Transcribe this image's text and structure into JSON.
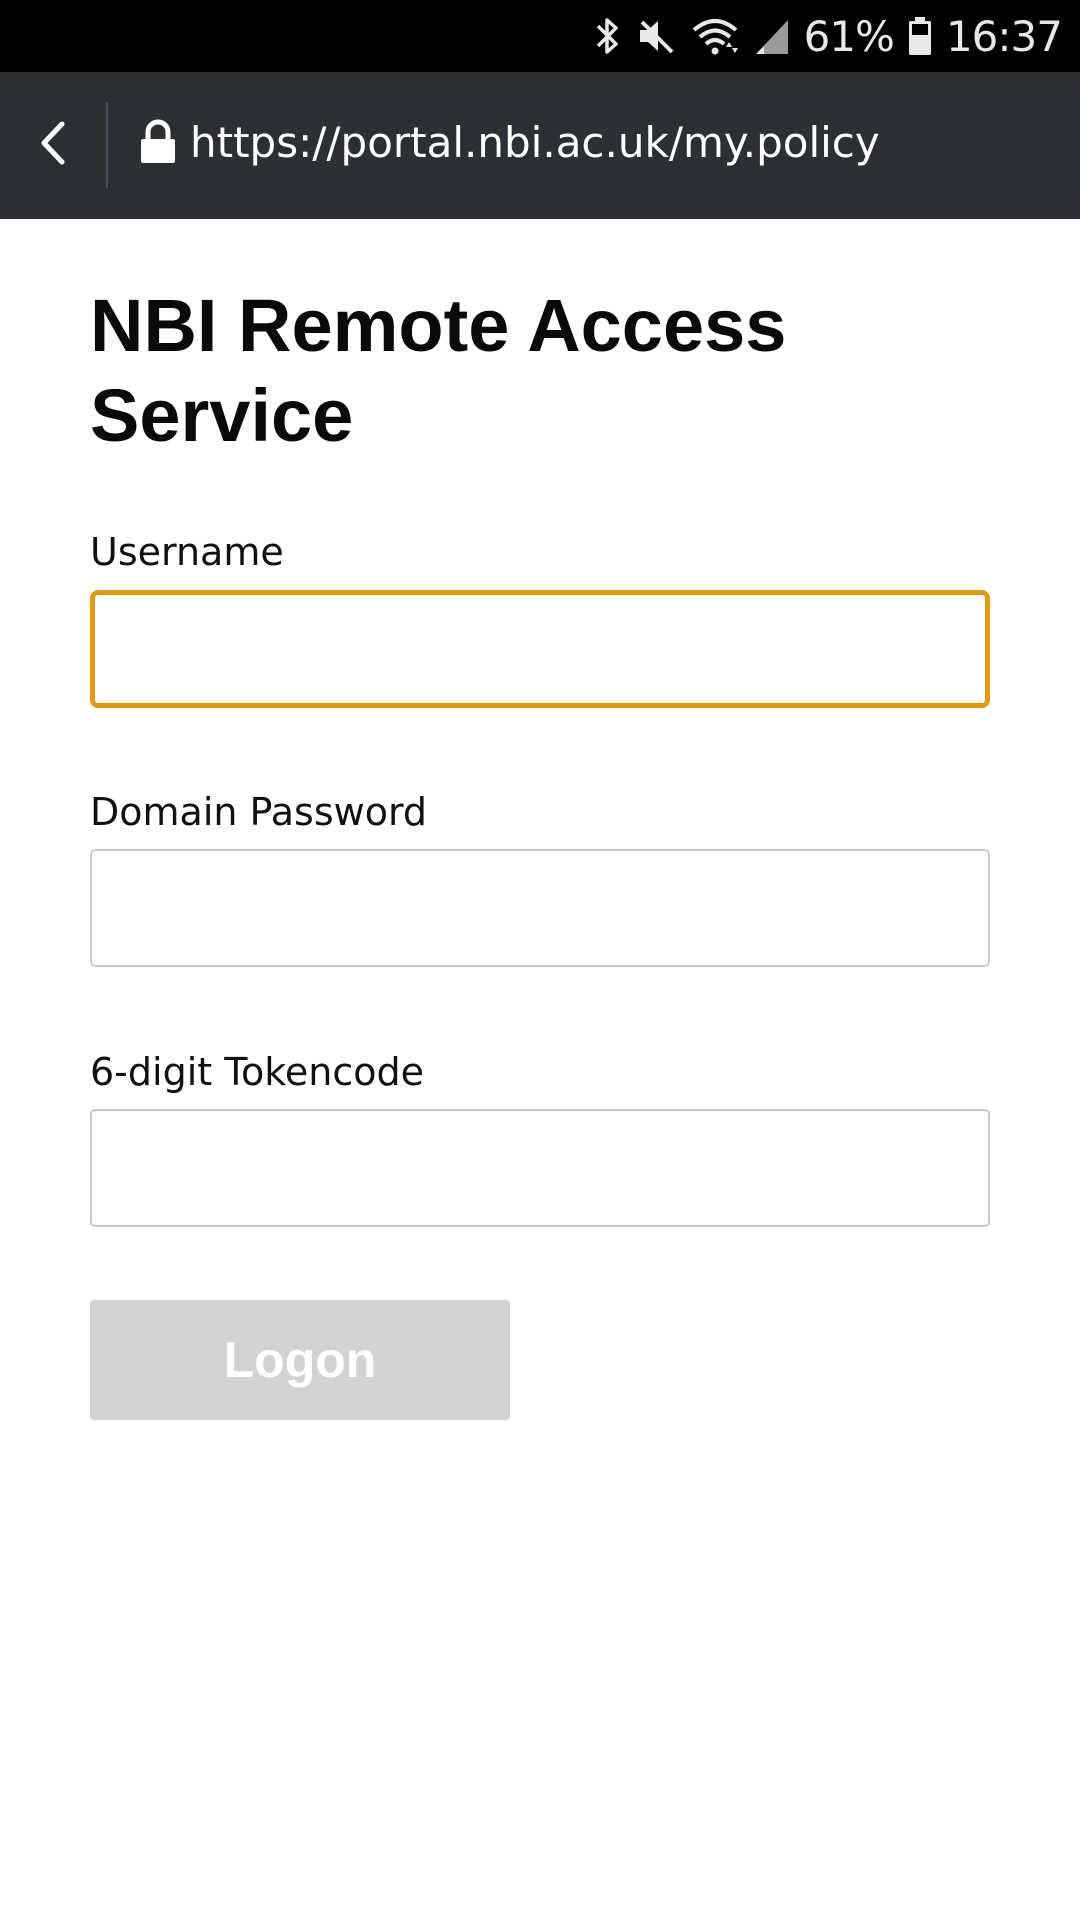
{
  "status_bar": {
    "battery_percent": "61%",
    "time": "16:37",
    "icons": [
      "bluetooth-icon",
      "mute-icon",
      "wifi-icon",
      "signal-icon",
      "battery-icon"
    ]
  },
  "browser": {
    "url": "https://portal.nbi.ac.uk/my.policy",
    "icons": [
      "back-arrow-icon",
      "lock-icon"
    ],
    "colors": {
      "toolbar": "#2c3035"
    }
  },
  "page": {
    "title": "NBI Remote Access Service",
    "fields": [
      {
        "label": "Username",
        "value": "",
        "focused": true
      },
      {
        "label": "Domain Password",
        "value": ""
      },
      {
        "label": "6-digit Tokencode",
        "value": ""
      }
    ],
    "logon_label": "Logon",
    "colors": {
      "focus_border": "#e09b12",
      "button_disabled": "#d2d2d2"
    }
  }
}
